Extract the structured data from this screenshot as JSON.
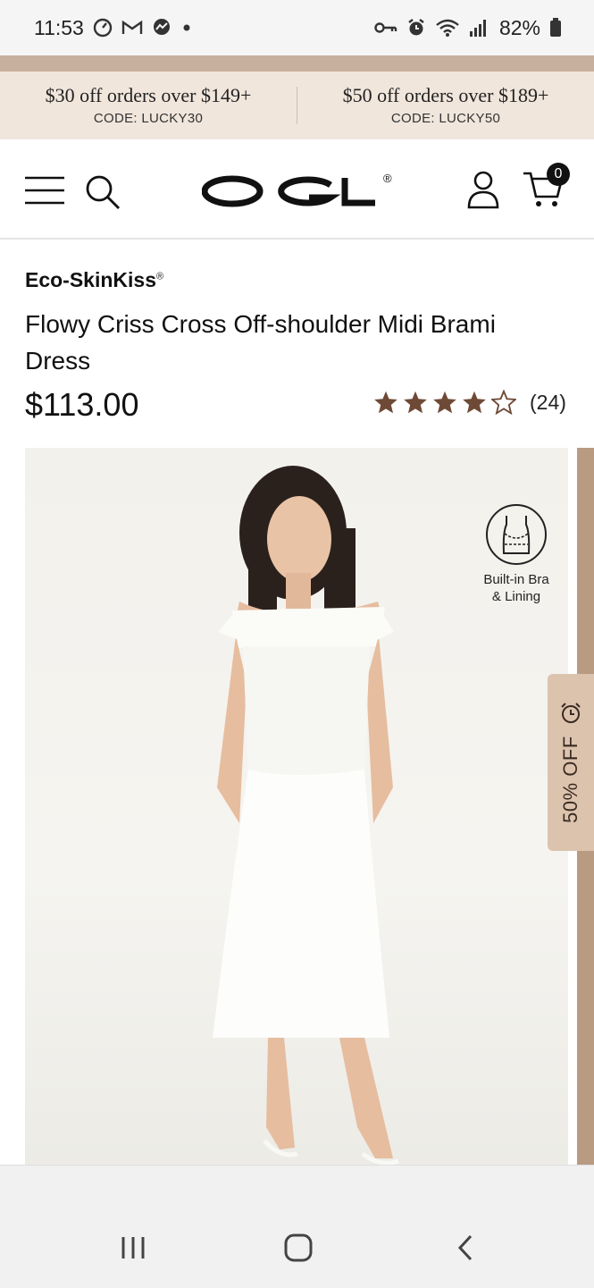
{
  "status_bar": {
    "time": "11:53",
    "battery": "82%",
    "left_icons": [
      "speedometer-icon",
      "gmail-icon",
      "messenger-icon",
      "dot-icon"
    ],
    "right_icons": [
      "vpn-key-icon",
      "alarm-icon",
      "wifi-icon",
      "signal-icon",
      "battery-icon"
    ]
  },
  "promos": [
    {
      "title": "$30 off orders over $149+",
      "code": "CODE: LUCKY30"
    },
    {
      "title": "$50 off orders over $189+",
      "code": "CODE: LUCKY50"
    }
  ],
  "header": {
    "logo": "OGL",
    "logo_mark": "®",
    "cart_count": "0",
    "icons": [
      "menu-icon",
      "search-icon",
      "account-icon",
      "cart-icon"
    ]
  },
  "product": {
    "brand": "Eco-SkinKiss",
    "brand_mark": "®",
    "title": "Flowy Criss Cross Off-shoulder Midi Brami Dress",
    "price": "$113.00",
    "rating": 4,
    "rating_max": 5,
    "review_count": "(24)"
  },
  "image_badges": {
    "feature_label_line1": "Built-in Bra",
    "feature_label_line2": "& Lining",
    "discount_label": "50% OFF"
  },
  "colors": {
    "promo_bg": "#f1e6dc",
    "star": "#6e4a36",
    "discount_tab": "#dcc3ae"
  },
  "nav": {
    "buttons": [
      "recent-apps",
      "home",
      "back"
    ]
  }
}
